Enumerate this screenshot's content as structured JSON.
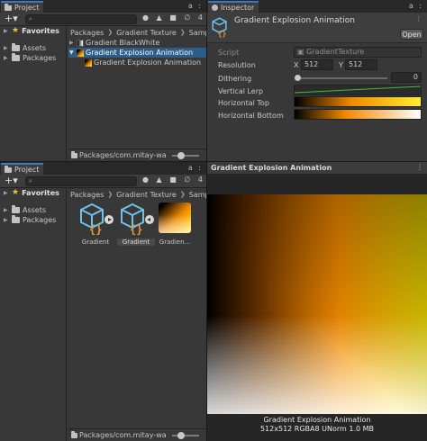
{
  "top_project": {
    "tab_label": "Project",
    "tab_controls": "a :",
    "toolbar_icons": "● ▲ ■ ∅ 4",
    "favorites": "Favorites",
    "assets": "Assets",
    "packages": "Packages",
    "breadcrumb": [
      "Packages",
      "Gradient Texture",
      "Sample"
    ],
    "items": [
      {
        "label": "Gradient BlackWhite",
        "selected": false
      },
      {
        "label": "Gradient Explosion Animation",
        "selected": true
      },
      {
        "label": "Gradient Explosion Animation",
        "selected": false
      }
    ],
    "path": "Packages/com.mitay-wa"
  },
  "bottom_project": {
    "tab_label": "Project",
    "tab_controls": "a :",
    "toolbar_icons": "● ▲ ■ ∅ 4",
    "favorites": "Favorites",
    "assets": "Assets",
    "packages": "Packages",
    "breadcrumb": [
      "Packages",
      "Gradient Texture",
      "Sample"
    ],
    "grid_items": [
      {
        "label": "Gradient",
        "selected": false
      },
      {
        "label": "Gradient",
        "selected": true
      },
      {
        "label": "Gradien...",
        "selected": false
      }
    ],
    "path": "Packages/com.mitay-wa"
  },
  "inspector": {
    "tab_label": "Inspector",
    "tab_controls": "a :",
    "asset_title": "Gradient Explosion Animation",
    "open_button": "Open",
    "script_label": "Script",
    "script_value": "GradientTexture",
    "resolution_label": "Resolution",
    "res_x_label": "X",
    "res_x": "512",
    "res_y_label": "Y",
    "res_y": "512",
    "dithering_label": "Dithering",
    "dithering_value": "0",
    "vertical_lerp_label": "Vertical Lerp",
    "horizontal_top_label": "Horizontal Top",
    "horizontal_bottom_label": "Horizontal Bottom"
  },
  "preview": {
    "header": "Gradient Explosion Animation",
    "caption_title": "Gradient Explosion Animation",
    "caption_info": "512x512  RGBA8 UNorm  1.0 MB"
  },
  "colors": {
    "accent": "#3a79bb",
    "selection": "#2c5d87",
    "gradient_orange": "#f08a00",
    "gradient_yellow": "#ffee33"
  }
}
